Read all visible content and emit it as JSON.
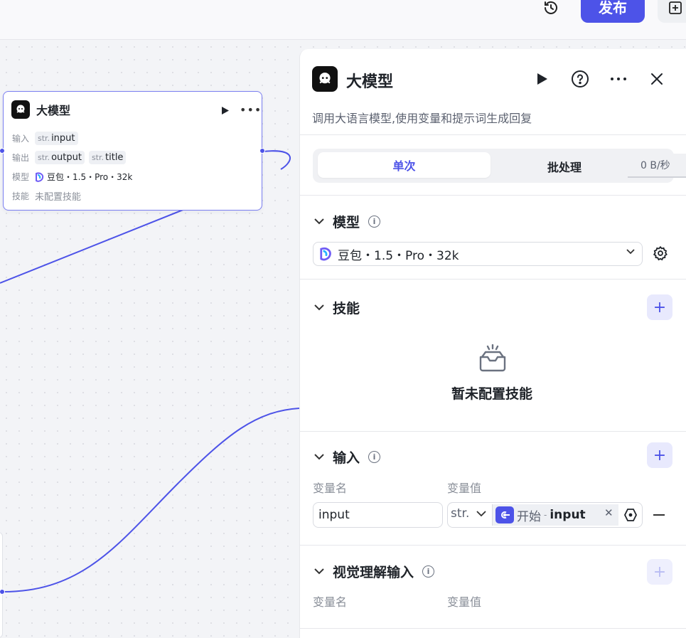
{
  "topbar": {
    "publish_label": "发布"
  },
  "canvas_node": {
    "title": "大模型",
    "input_label": "输入",
    "output_label": "输出",
    "model_label": "模型",
    "skills_label": "技能",
    "inputs": [
      {
        "type": "str.",
        "name": "input"
      }
    ],
    "outputs": [
      {
        "type": "str.",
        "name": "output"
      },
      {
        "type": "str.",
        "name": "title"
      }
    ],
    "model": "豆包・1.5・Pro・32k",
    "skills_value": "未配置技能"
  },
  "panel": {
    "title": "大模型",
    "description": "调用大语言模型,使用变量和提示词生成回复",
    "tabs": {
      "single": "单次",
      "batch": "批处理"
    },
    "speed": "0 B/秒",
    "model_section": {
      "title": "模型",
      "selected": "豆包・1.5・Pro・32k"
    },
    "skills_section": {
      "title": "技能",
      "empty_text": "暂未配置技能"
    },
    "input_section": {
      "title": "输入",
      "col_name": "变量名",
      "col_value": "变量值",
      "rows": [
        {
          "name": "input",
          "type": "str.",
          "ref_node": "开始",
          "ref_sep": "-",
          "ref_var": "input"
        }
      ]
    },
    "vision_section": {
      "title": "视觉理解输入",
      "col_name": "变量名",
      "col_value": "变量值"
    }
  },
  "colors": {
    "accent": "#4d53e8",
    "edge": "#4d53e8"
  }
}
